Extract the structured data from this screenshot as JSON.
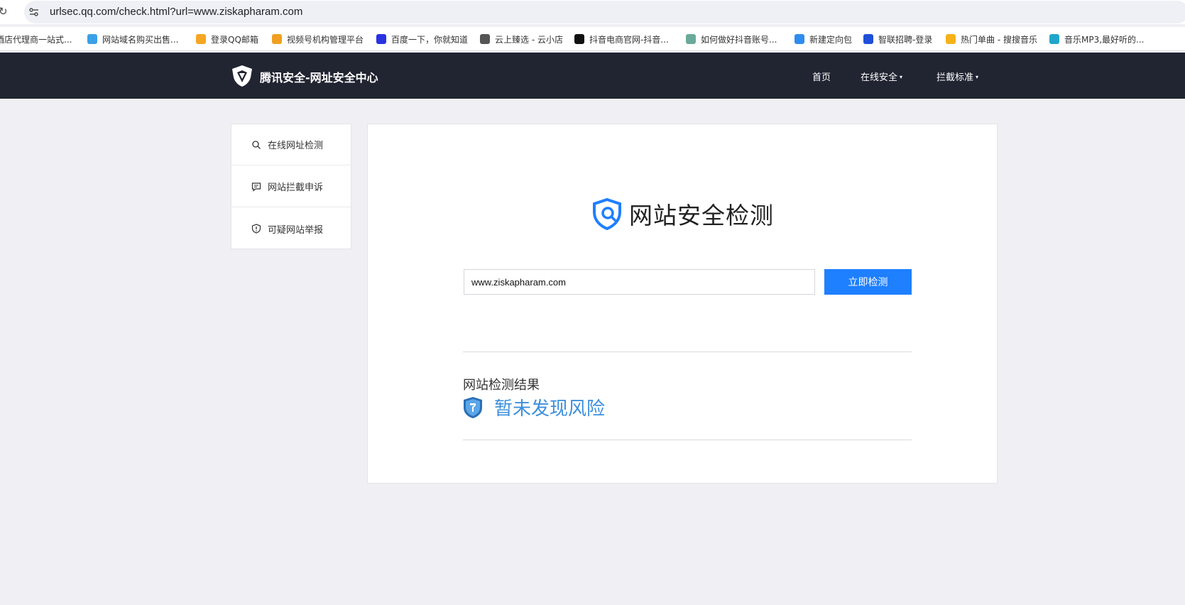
{
  "browser": {
    "url": "urlsec.qq.com/check.html?url=www.ziskapharam.com",
    "bookmarks": [
      {
        "label": "酒店代理商一站式...",
        "icon": "hotel-icon",
        "color": "#cccccc"
      },
      {
        "label": "网站域名购买出售...",
        "icon": "domain-icon",
        "color": "#3aa0e8"
      },
      {
        "label": "登录QQ邮箱",
        "icon": "qqmail-icon",
        "color": "#f5a623"
      },
      {
        "label": "视频号机构管理平台",
        "icon": "channels-icon",
        "color": "#f0a020"
      },
      {
        "label": "百度一下，你就知道",
        "icon": "baidu-icon",
        "color": "#2932e1"
      },
      {
        "label": "云上臻选 - 云小店",
        "icon": "globe-icon",
        "color": "#555555"
      },
      {
        "label": "抖音电商官网-抖音...",
        "icon": "douyin-icon",
        "color": "#111111"
      },
      {
        "label": "如何做好抖音账号...",
        "icon": "trophy-icon",
        "color": "#6aaa9a"
      },
      {
        "label": "新建定向包",
        "icon": "chart-icon",
        "color": "#2d8cf0"
      },
      {
        "label": "智联招聘-登录",
        "icon": "zhilian-icon",
        "color": "#1f4fd8"
      },
      {
        "label": "热门单曲 - 搜搜音乐",
        "icon": "sogou-icon",
        "color": "#f6b21a"
      },
      {
        "label": "音乐MP3,最好听的...",
        "icon": "music-icon",
        "color": "#21a6c9"
      }
    ]
  },
  "header": {
    "logo_text": "腾讯安全-网址安全中心",
    "nav": [
      {
        "label": "首页",
        "has_caret": false
      },
      {
        "label": "在线安全",
        "has_caret": true
      },
      {
        "label": "拦截标准",
        "has_caret": true
      }
    ],
    "caret": "▾"
  },
  "sidebar": {
    "items": [
      {
        "label": "在线网址检测",
        "icon": "search-icon"
      },
      {
        "label": "网站拦截申诉",
        "icon": "chat-icon"
      },
      {
        "label": "可疑网站举报",
        "icon": "shield-alert-icon"
      }
    ]
  },
  "main": {
    "title": "网站安全检测",
    "input_value": "www.ziskapharam.com",
    "button_label": "立即检测",
    "result_label": "网站检测结果",
    "result_text": "暂未发现风险"
  },
  "colors": {
    "header_bg": "#212431",
    "accent": "#1e7fff",
    "result_blue": "#3c8fdc",
    "page_bg": "#efeff4"
  }
}
